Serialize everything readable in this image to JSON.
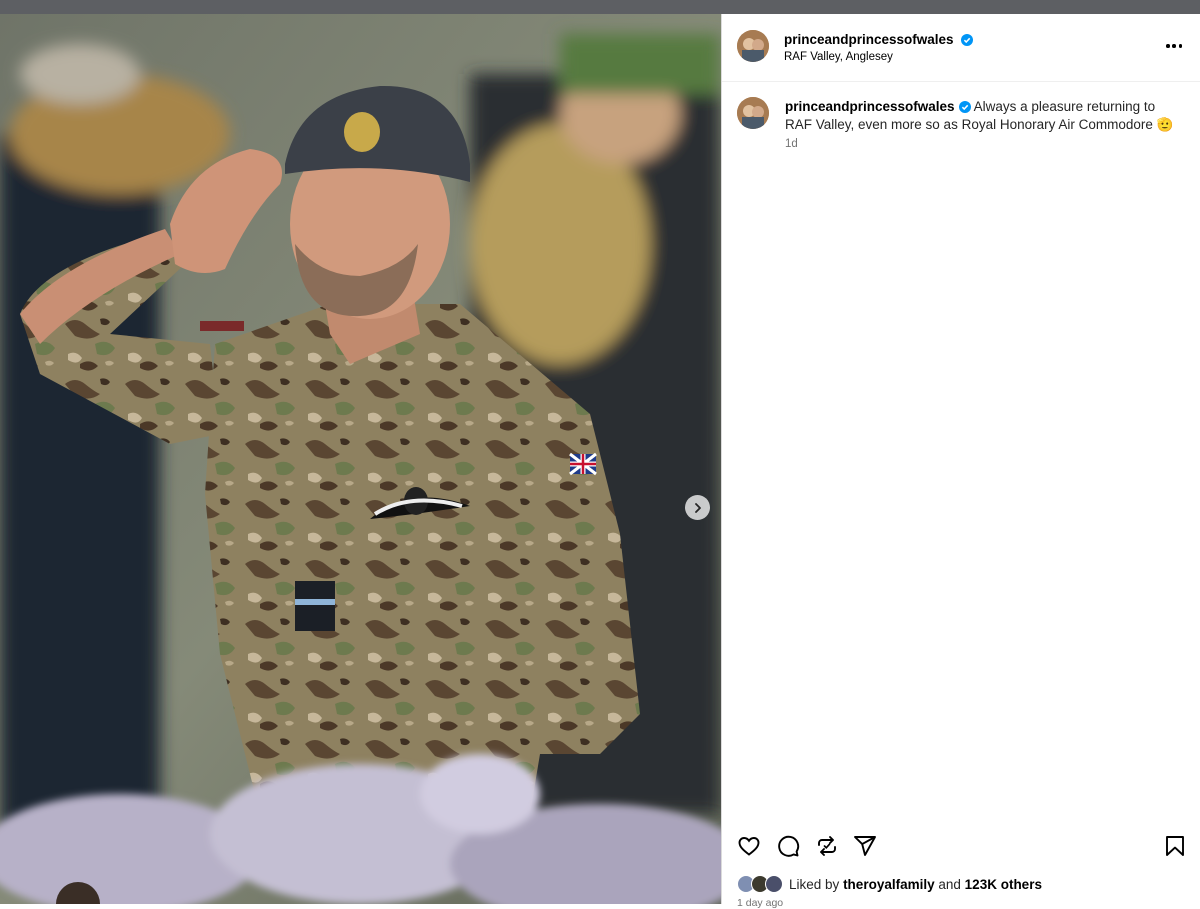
{
  "post": {
    "username": "princeandprincessofwales",
    "location": "RAF Valley, Anglesey",
    "caption_text": "Always a pleasure returning to RAF Valley, even more so as Royal Honorary Air Commodore 🫡",
    "time_ago": "1d",
    "likes": {
      "liked_by_prefix": "Liked by",
      "liked_by_user": "theroyalfamily",
      "and_text": "and",
      "count_text": "123K others"
    },
    "posted_time": "1 day ago"
  },
  "media": {
    "description_icon": "photo-slide",
    "next_icon": "chevron-right-icon"
  },
  "icons": {
    "verified": "verified-badge-icon",
    "more": "more-options-icon",
    "like": "heart-icon",
    "comment": "comment-icon",
    "repost": "repost-icon",
    "share": "share-icon",
    "save": "bookmark-icon"
  },
  "colors": {
    "verified": "#0095f6",
    "secondary_text": "#737373",
    "divider": "#dbdbdb"
  }
}
